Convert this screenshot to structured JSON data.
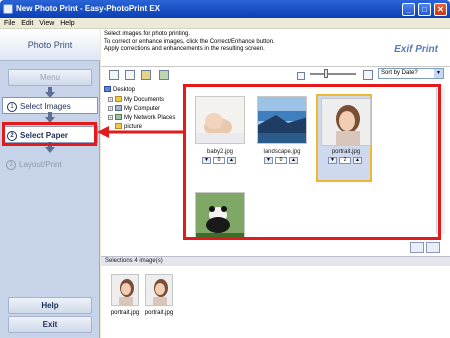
{
  "window": {
    "title": "New Photo Print - Easy-PhotoPrint EX",
    "minimize_glyph": "_",
    "maximize_glyph": "□",
    "close_glyph": "✕"
  },
  "menu": [
    "File",
    "Edit",
    "View",
    "Help"
  ],
  "sidebar": {
    "header": "Photo Print",
    "menu_button": "Menu",
    "steps": [
      {
        "num": "1",
        "label": "Select Images"
      },
      {
        "num": "2",
        "label": "Select Paper"
      },
      {
        "num": "3",
        "label": "Layout/Print"
      }
    ],
    "help_button": "Help",
    "exit_button": "Exit"
  },
  "instructions": {
    "line1": "Select images for photo printing.",
    "line2": "To correct or enhance images, click the Correct/Enhance button.",
    "line3": "Apply corrections and enhancements in the resulting screen."
  },
  "logo": "Exif Print",
  "sort": {
    "selected": "Sort by Date?"
  },
  "tree": {
    "root": "Desktop",
    "items": [
      "My Documents",
      "My Computer",
      "My Network Places",
      "picture"
    ]
  },
  "images": [
    {
      "name": "baby2.jpg",
      "count": "0"
    },
    {
      "name": "landscape.jpg",
      "count": "0"
    },
    {
      "name": "portrait.jpg",
      "count": "2"
    },
    {
      "name": "",
      "count": ""
    }
  ],
  "selections": {
    "label": "Selections 4 image(s)",
    "items": [
      "portrait.jpg",
      "portrait.jpg"
    ]
  },
  "colors": {
    "highlight_red": "#e41a1a",
    "selected_border": "#f0b830",
    "titlebar_blue": "#0b3fb4"
  }
}
